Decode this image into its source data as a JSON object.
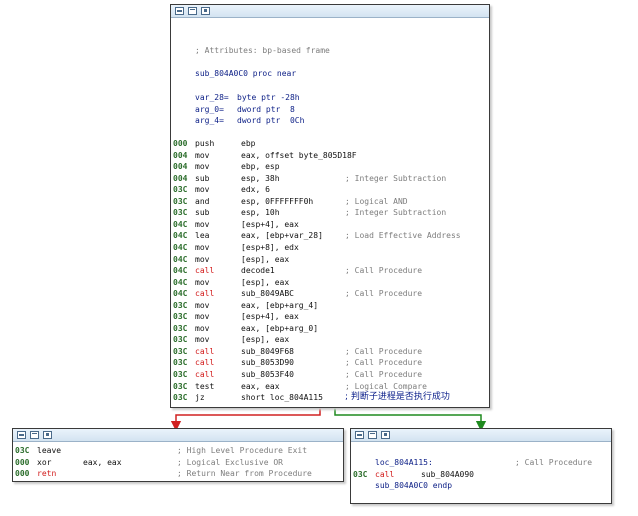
{
  "main_block": {
    "attributes_comment": "; Attributes: bp-based frame",
    "proc_decl": "sub_804A0C0 proc near",
    "vars": [
      {
        "name": "var_28=",
        "type": "byte ptr -28h"
      },
      {
        "name": "arg_0=",
        "type": "dword ptr  8"
      },
      {
        "name": "arg_4=",
        "type": "dword ptr  0Ch"
      }
    ],
    "instructions": [
      {
        "addr": "000",
        "mn": "push",
        "op": "ebp",
        "comment": "",
        "mn_color": "black"
      },
      {
        "addr": "004",
        "mn": "mov",
        "op": "eax, offset byte_805D18F",
        "comment": "",
        "mn_color": "black"
      },
      {
        "addr": "004",
        "mn": "mov",
        "op": "ebp, esp",
        "comment": "",
        "mn_color": "black"
      },
      {
        "addr": "004",
        "mn": "sub",
        "op": "esp, 38h",
        "comment": "; Integer Subtraction",
        "mn_color": "black"
      },
      {
        "addr": "03C",
        "mn": "mov",
        "op": "edx, 6",
        "comment": "",
        "mn_color": "black"
      },
      {
        "addr": "03C",
        "mn": "and",
        "op": "esp, 0FFFFFFF0h",
        "comment": "; Logical AND",
        "mn_color": "black"
      },
      {
        "addr": "03C",
        "mn": "sub",
        "op": "esp, 10h",
        "comment": "; Integer Subtraction",
        "mn_color": "black"
      },
      {
        "addr": "04C",
        "mn": "mov",
        "op": "[esp+4], eax",
        "comment": "",
        "mn_color": "black"
      },
      {
        "addr": "04C",
        "mn": "lea",
        "op": "eax, [ebp+var_28]",
        "comment": "; Load Effective Address",
        "mn_color": "black"
      },
      {
        "addr": "04C",
        "mn": "mov",
        "op": "[esp+8], edx",
        "comment": "",
        "mn_color": "black"
      },
      {
        "addr": "04C",
        "mn": "mov",
        "op": "[esp], eax",
        "comment": "",
        "mn_color": "black"
      },
      {
        "addr": "04C",
        "mn": "call",
        "op": "decode1",
        "comment": "; Call Procedure",
        "mn_color": "red"
      },
      {
        "addr": "04C",
        "mn": "mov",
        "op": "[esp], eax",
        "comment": "",
        "mn_color": "black"
      },
      {
        "addr": "04C",
        "mn": "call",
        "op": "sub_8049ABC",
        "comment": "; Call Procedure",
        "mn_color": "red"
      },
      {
        "addr": "03C",
        "mn": "mov",
        "op": "eax, [ebp+arg_4]",
        "comment": "",
        "mn_color": "black"
      },
      {
        "addr": "03C",
        "mn": "mov",
        "op": "[esp+4], eax",
        "comment": "",
        "mn_color": "black"
      },
      {
        "addr": "03C",
        "mn": "mov",
        "op": "eax, [ebp+arg_0]",
        "comment": "",
        "mn_color": "black"
      },
      {
        "addr": "03C",
        "mn": "mov",
        "op": "[esp], eax",
        "comment": "",
        "mn_color": "black"
      },
      {
        "addr": "03C",
        "mn": "call",
        "op": "sub_8049F68",
        "comment": "; Call Procedure",
        "mn_color": "red"
      },
      {
        "addr": "03C",
        "mn": "call",
        "op": "sub_8053D90",
        "comment": "; Call Procedure",
        "mn_color": "red"
      },
      {
        "addr": "03C",
        "mn": "call",
        "op": "sub_8053F40",
        "comment": "; Call Procedure",
        "mn_color": "red"
      },
      {
        "addr": "03C",
        "mn": "test",
        "op": "eax, eax",
        "comment": "; Logical Compare",
        "mn_color": "black"
      },
      {
        "addr": "03C",
        "mn": "jz",
        "op": "short loc_804A115",
        "comment": "; 判断子进程是否执行成功",
        "mn_color": "black"
      }
    ]
  },
  "left_block": {
    "instructions": [
      {
        "addr": "03C",
        "mn": "leave",
        "op": "",
        "comment": "; High Level Procedure Exit",
        "mn_color": "black"
      },
      {
        "addr": "000",
        "mn": "xor",
        "op": "eax, eax",
        "comment": "; Logical Exclusive OR",
        "mn_color": "black"
      },
      {
        "addr": "000",
        "mn": "retn",
        "op": "",
        "comment": "; Return Near from Procedure",
        "mn_color": "red"
      }
    ]
  },
  "right_block": {
    "label": "loc_804A115:",
    "label_comment": "; Call Procedure",
    "instructions": [
      {
        "addr": "03C",
        "mn": "call",
        "op": "sub_804A090",
        "comment": "",
        "mn_color": "red"
      }
    ],
    "endp": "sub_804A0C0 endp"
  },
  "colors": {
    "false_branch": "#d02020",
    "true_branch": "#1f8a1f",
    "addr_green": "#2c6e2c",
    "label_blue": "#0b1e86"
  }
}
